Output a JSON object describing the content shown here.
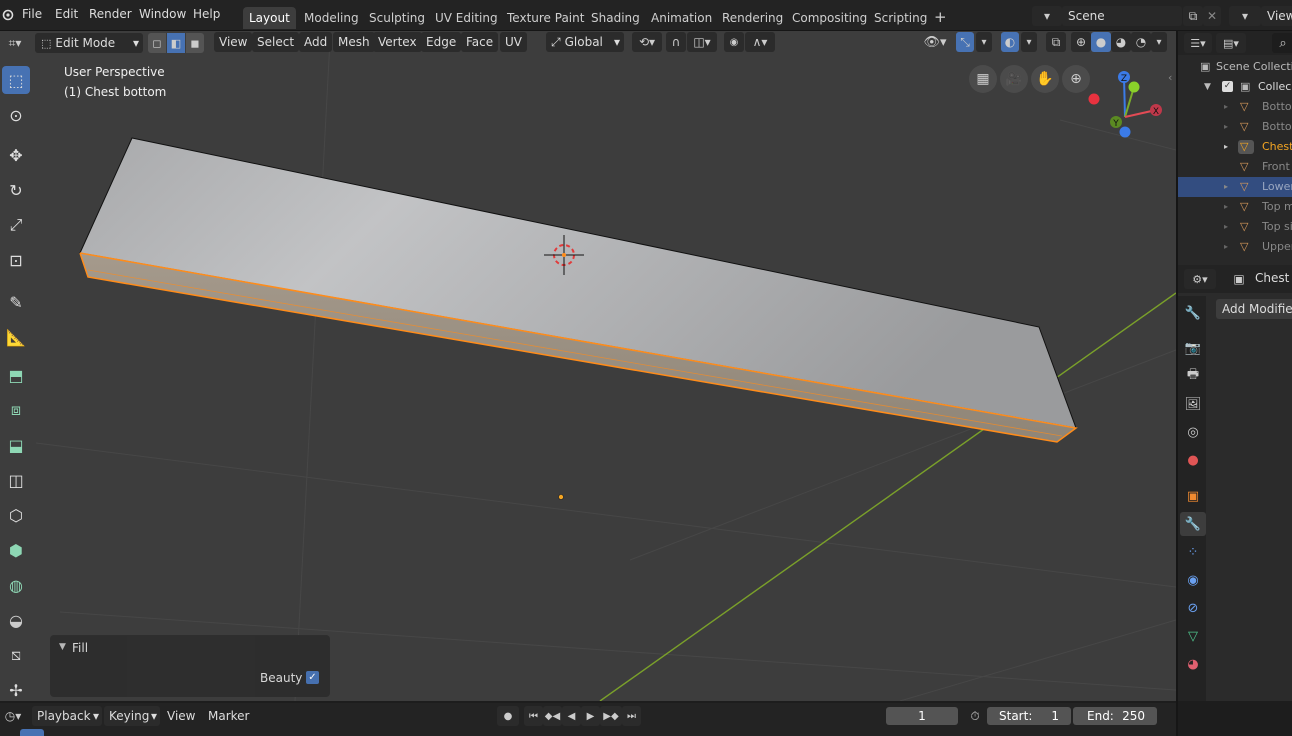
{
  "topbar": {
    "menus": [
      "File",
      "Edit",
      "Render",
      "Window",
      "Help"
    ],
    "workspaces": [
      "Layout",
      "Modeling",
      "Sculpting",
      "UV Editing",
      "Texture Paint",
      "Shading",
      "Animation",
      "Rendering",
      "Compositing",
      "Scripting"
    ],
    "active_workspace": "Layout",
    "add_tab": "+",
    "scene": "Scene",
    "view_layer": "View"
  },
  "viewport_header": {
    "mode": "Edit Mode",
    "menus": [
      "View",
      "Select",
      "Add",
      "Mesh",
      "Vertex",
      "Edge",
      "Face",
      "UV"
    ],
    "orientation": "Global"
  },
  "viewport": {
    "perspective": "User Perspective",
    "object_label": "(1) Chest bottom",
    "axis_x": "X",
    "axis_y": "Y",
    "axis_z": "Z"
  },
  "fill_panel": {
    "title": "Fill",
    "beauty_label": "Beauty",
    "beauty_checked": true
  },
  "outliner": {
    "scene_collection": "Scene Collecti",
    "collection": "Collec",
    "items": [
      "Bottor",
      "Bottor",
      "Chest",
      "Front",
      "Lower",
      "Top m",
      "Top si",
      "Upper"
    ]
  },
  "properties": {
    "object_name": "Chest b",
    "add_modifier": "Add Modifier"
  },
  "timeline": {
    "playback": "Playback",
    "keying": "Keying",
    "view": "View",
    "marker": "Marker",
    "current_frame": "1",
    "start_label": "Start:",
    "start": "1",
    "end_label": "End:",
    "end": "250"
  },
  "colors": {
    "accent": "#4772b3",
    "selected_edge": "#ff8c1a",
    "active_object": "#f5a623",
    "viewport_bg": "#3d3d3d",
    "axis_x": "#e34b55",
    "axis_y": "#7aad2a",
    "axis_z": "#3b7be8"
  }
}
